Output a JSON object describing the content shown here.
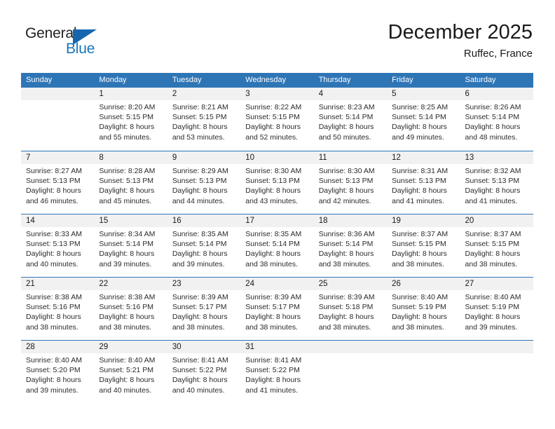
{
  "brand": {
    "name_part1": "General",
    "name_part2": "Blue",
    "accent_color": "#1b75bb",
    "triangle_color": "#1666ae"
  },
  "header": {
    "title": "December 2025",
    "subtitle": "Ruffec, France"
  },
  "theme": {
    "header_row_bg": "#2e75b6",
    "date_band_bg": "#f1f1f1",
    "week_rule_color": "#2e75b6"
  },
  "weekdays": [
    "Sunday",
    "Monday",
    "Tuesday",
    "Wednesday",
    "Thursday",
    "Friday",
    "Saturday"
  ],
  "weeks": [
    [
      {
        "day": "",
        "sunrise": "",
        "sunset": "",
        "daylight1": "",
        "daylight2": "",
        "empty": true
      },
      {
        "day": "1",
        "sunrise": "Sunrise: 8:20 AM",
        "sunset": "Sunset: 5:15 PM",
        "daylight1": "Daylight: 8 hours",
        "daylight2": "and 55 minutes."
      },
      {
        "day": "2",
        "sunrise": "Sunrise: 8:21 AM",
        "sunset": "Sunset: 5:15 PM",
        "daylight1": "Daylight: 8 hours",
        "daylight2": "and 53 minutes."
      },
      {
        "day": "3",
        "sunrise": "Sunrise: 8:22 AM",
        "sunset": "Sunset: 5:15 PM",
        "daylight1": "Daylight: 8 hours",
        "daylight2": "and 52 minutes."
      },
      {
        "day": "4",
        "sunrise": "Sunrise: 8:23 AM",
        "sunset": "Sunset: 5:14 PM",
        "daylight1": "Daylight: 8 hours",
        "daylight2": "and 50 minutes."
      },
      {
        "day": "5",
        "sunrise": "Sunrise: 8:25 AM",
        "sunset": "Sunset: 5:14 PM",
        "daylight1": "Daylight: 8 hours",
        "daylight2": "and 49 minutes."
      },
      {
        "day": "6",
        "sunrise": "Sunrise: 8:26 AM",
        "sunset": "Sunset: 5:14 PM",
        "daylight1": "Daylight: 8 hours",
        "daylight2": "and 48 minutes."
      }
    ],
    [
      {
        "day": "7",
        "sunrise": "Sunrise: 8:27 AM",
        "sunset": "Sunset: 5:13 PM",
        "daylight1": "Daylight: 8 hours",
        "daylight2": "and 46 minutes."
      },
      {
        "day": "8",
        "sunrise": "Sunrise: 8:28 AM",
        "sunset": "Sunset: 5:13 PM",
        "daylight1": "Daylight: 8 hours",
        "daylight2": "and 45 minutes."
      },
      {
        "day": "9",
        "sunrise": "Sunrise: 8:29 AM",
        "sunset": "Sunset: 5:13 PM",
        "daylight1": "Daylight: 8 hours",
        "daylight2": "and 44 minutes."
      },
      {
        "day": "10",
        "sunrise": "Sunrise: 8:30 AM",
        "sunset": "Sunset: 5:13 PM",
        "daylight1": "Daylight: 8 hours",
        "daylight2": "and 43 minutes."
      },
      {
        "day": "11",
        "sunrise": "Sunrise: 8:30 AM",
        "sunset": "Sunset: 5:13 PM",
        "daylight1": "Daylight: 8 hours",
        "daylight2": "and 42 minutes."
      },
      {
        "day": "12",
        "sunrise": "Sunrise: 8:31 AM",
        "sunset": "Sunset: 5:13 PM",
        "daylight1": "Daylight: 8 hours",
        "daylight2": "and 41 minutes."
      },
      {
        "day": "13",
        "sunrise": "Sunrise: 8:32 AM",
        "sunset": "Sunset: 5:13 PM",
        "daylight1": "Daylight: 8 hours",
        "daylight2": "and 41 minutes."
      }
    ],
    [
      {
        "day": "14",
        "sunrise": "Sunrise: 8:33 AM",
        "sunset": "Sunset: 5:13 PM",
        "daylight1": "Daylight: 8 hours",
        "daylight2": "and 40 minutes."
      },
      {
        "day": "15",
        "sunrise": "Sunrise: 8:34 AM",
        "sunset": "Sunset: 5:14 PM",
        "daylight1": "Daylight: 8 hours",
        "daylight2": "and 39 minutes."
      },
      {
        "day": "16",
        "sunrise": "Sunrise: 8:35 AM",
        "sunset": "Sunset: 5:14 PM",
        "daylight1": "Daylight: 8 hours",
        "daylight2": "and 39 minutes."
      },
      {
        "day": "17",
        "sunrise": "Sunrise: 8:35 AM",
        "sunset": "Sunset: 5:14 PM",
        "daylight1": "Daylight: 8 hours",
        "daylight2": "and 38 minutes."
      },
      {
        "day": "18",
        "sunrise": "Sunrise: 8:36 AM",
        "sunset": "Sunset: 5:14 PM",
        "daylight1": "Daylight: 8 hours",
        "daylight2": "and 38 minutes."
      },
      {
        "day": "19",
        "sunrise": "Sunrise: 8:37 AM",
        "sunset": "Sunset: 5:15 PM",
        "daylight1": "Daylight: 8 hours",
        "daylight2": "and 38 minutes."
      },
      {
        "day": "20",
        "sunrise": "Sunrise: 8:37 AM",
        "sunset": "Sunset: 5:15 PM",
        "daylight1": "Daylight: 8 hours",
        "daylight2": "and 38 minutes."
      }
    ],
    [
      {
        "day": "21",
        "sunrise": "Sunrise: 8:38 AM",
        "sunset": "Sunset: 5:16 PM",
        "daylight1": "Daylight: 8 hours",
        "daylight2": "and 38 minutes."
      },
      {
        "day": "22",
        "sunrise": "Sunrise: 8:38 AM",
        "sunset": "Sunset: 5:16 PM",
        "daylight1": "Daylight: 8 hours",
        "daylight2": "and 38 minutes."
      },
      {
        "day": "23",
        "sunrise": "Sunrise: 8:39 AM",
        "sunset": "Sunset: 5:17 PM",
        "daylight1": "Daylight: 8 hours",
        "daylight2": "and 38 minutes."
      },
      {
        "day": "24",
        "sunrise": "Sunrise: 8:39 AM",
        "sunset": "Sunset: 5:17 PM",
        "daylight1": "Daylight: 8 hours",
        "daylight2": "and 38 minutes."
      },
      {
        "day": "25",
        "sunrise": "Sunrise: 8:39 AM",
        "sunset": "Sunset: 5:18 PM",
        "daylight1": "Daylight: 8 hours",
        "daylight2": "and 38 minutes."
      },
      {
        "day": "26",
        "sunrise": "Sunrise: 8:40 AM",
        "sunset": "Sunset: 5:19 PM",
        "daylight1": "Daylight: 8 hours",
        "daylight2": "and 38 minutes."
      },
      {
        "day": "27",
        "sunrise": "Sunrise: 8:40 AM",
        "sunset": "Sunset: 5:19 PM",
        "daylight1": "Daylight: 8 hours",
        "daylight2": "and 39 minutes."
      }
    ],
    [
      {
        "day": "28",
        "sunrise": "Sunrise: 8:40 AM",
        "sunset": "Sunset: 5:20 PM",
        "daylight1": "Daylight: 8 hours",
        "daylight2": "and 39 minutes."
      },
      {
        "day": "29",
        "sunrise": "Sunrise: 8:40 AM",
        "sunset": "Sunset: 5:21 PM",
        "daylight1": "Daylight: 8 hours",
        "daylight2": "and 40 minutes."
      },
      {
        "day": "30",
        "sunrise": "Sunrise: 8:41 AM",
        "sunset": "Sunset: 5:22 PM",
        "daylight1": "Daylight: 8 hours",
        "daylight2": "and 40 minutes."
      },
      {
        "day": "31",
        "sunrise": "Sunrise: 8:41 AM",
        "sunset": "Sunset: 5:22 PM",
        "daylight1": "Daylight: 8 hours",
        "daylight2": "and 41 minutes."
      },
      {
        "day": "",
        "sunrise": "",
        "sunset": "",
        "daylight1": "",
        "daylight2": "",
        "empty": true
      },
      {
        "day": "",
        "sunrise": "",
        "sunset": "",
        "daylight1": "",
        "daylight2": "",
        "empty": true
      },
      {
        "day": "",
        "sunrise": "",
        "sunset": "",
        "daylight1": "",
        "daylight2": "",
        "empty": true
      }
    ]
  ]
}
